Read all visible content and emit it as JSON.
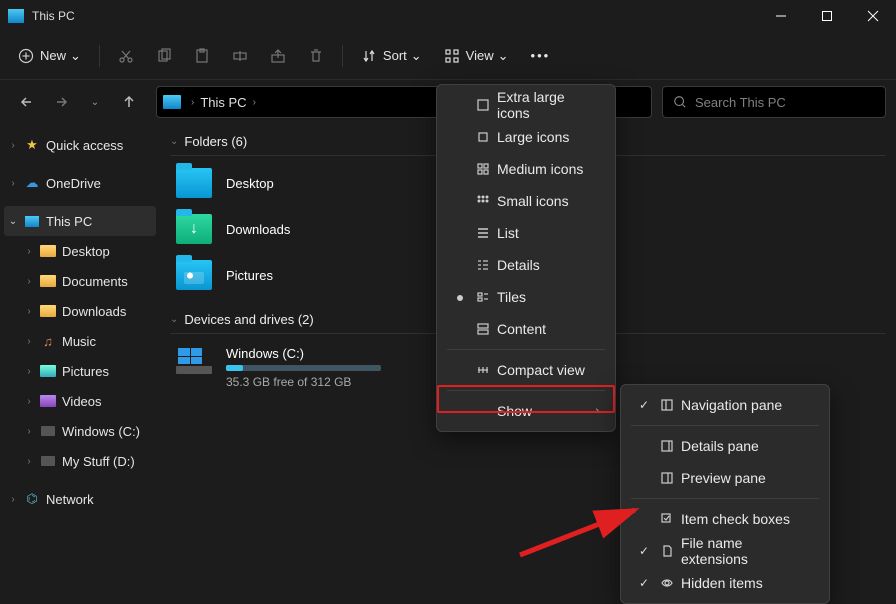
{
  "titlebar": {
    "title": "This PC"
  },
  "toolbar": {
    "new_label": "New",
    "sort_label": "Sort",
    "view_label": "View"
  },
  "address": {
    "crumb1": "This PC"
  },
  "search": {
    "placeholder": "Search This PC"
  },
  "sidebar": {
    "quick_access": "Quick access",
    "onedrive": "OneDrive",
    "this_pc": "This PC",
    "desktop": "Desktop",
    "documents": "Documents",
    "downloads": "Downloads",
    "music": "Music",
    "pictures": "Pictures",
    "videos": "Videos",
    "windows_c": "Windows (C:)",
    "mystuff_d": "My Stuff (D:)",
    "network": "Network"
  },
  "content": {
    "folders_header": "Folders (6)",
    "devices_header": "Devices and drives (2)",
    "desktop": "Desktop",
    "downloads": "Downloads",
    "pictures": "Pictures",
    "drive_c_name": "Windows (C:)",
    "drive_c_sub": "35.3 GB free of 312 GB"
  },
  "view_menu": {
    "xl_icons": "Extra large icons",
    "l_icons": "Large icons",
    "m_icons": "Medium icons",
    "s_icons": "Small icons",
    "list": "List",
    "details": "Details",
    "tiles": "Tiles",
    "content": "Content",
    "compact": "Compact view",
    "show": "Show"
  },
  "show_menu": {
    "nav_pane": "Navigation pane",
    "details_pane": "Details pane",
    "preview_pane": "Preview pane",
    "item_checkboxes": "Item check boxes",
    "file_ext": "File name extensions",
    "hidden": "Hidden items"
  }
}
